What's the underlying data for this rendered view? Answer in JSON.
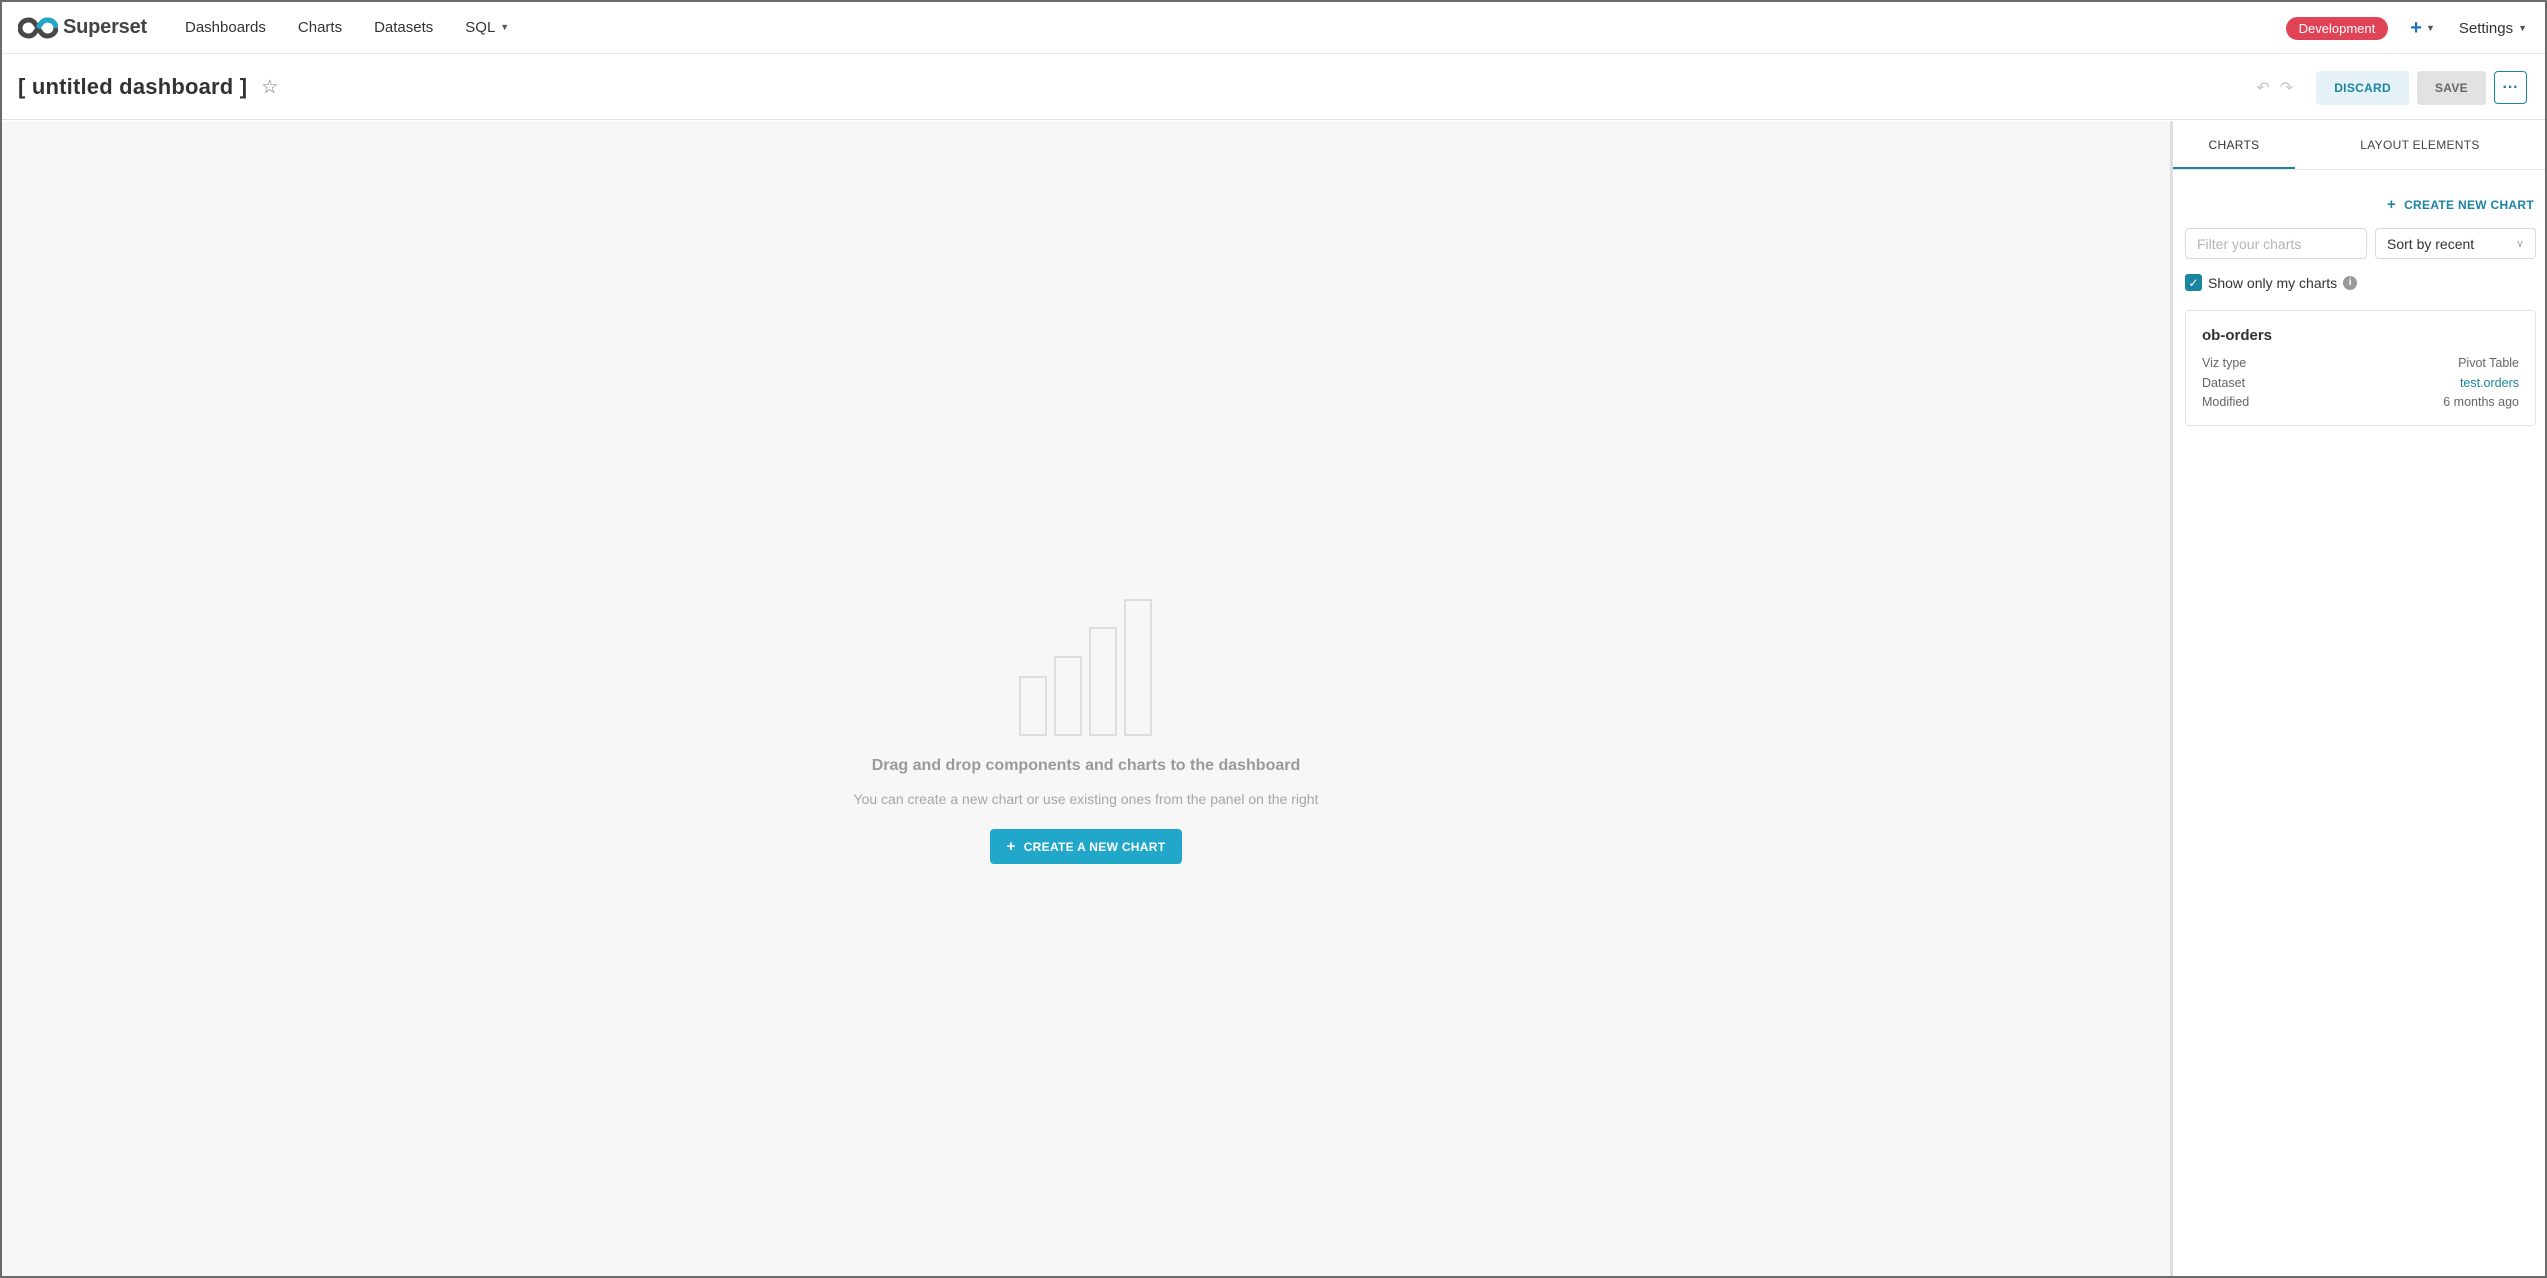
{
  "topnav": {
    "brand": "Superset",
    "items": [
      {
        "label": "Dashboards"
      },
      {
        "label": "Charts"
      },
      {
        "label": "Datasets"
      },
      {
        "label": "SQL"
      }
    ],
    "env_badge": "Development",
    "plus_label": "+",
    "settings_label": "Settings"
  },
  "header": {
    "title": "[ untitled dashboard ]",
    "discard_label": "DISCARD",
    "save_label": "SAVE",
    "more_label": "···"
  },
  "canvas": {
    "empty_title": "Drag and drop components and charts to the dashboard",
    "empty_subtitle": "You can create a new chart or use existing ones from the panel on the right",
    "create_button": "CREATE A NEW CHART"
  },
  "panel": {
    "tabs": [
      {
        "label": "CHARTS"
      },
      {
        "label": "LAYOUT ELEMENTS"
      }
    ],
    "create_link": "CREATE NEW CHART",
    "filter_placeholder": "Filter your charts",
    "sort_value": "Sort by recent",
    "show_mine_label": "Show only my charts",
    "card": {
      "title": "ob-orders",
      "rows": [
        {
          "label": "Viz type",
          "value": "Pivot Table"
        },
        {
          "label": "Dataset",
          "value": "test.orders"
        },
        {
          "label": "Modified",
          "value": "6 months ago"
        }
      ]
    }
  },
  "colors": {
    "accent": "#1a85a0",
    "primary_button": "#20a7c9",
    "badge": "#e04355",
    "canvas_bg": "#f7f7f7"
  },
  "icons": [
    "superset-logo-icon",
    "caret-down-icon",
    "plus-icon",
    "star-icon",
    "undo-icon",
    "redo-icon",
    "more-icon",
    "empty-chart-icon",
    "chevron-down-icon",
    "check-icon",
    "info-icon"
  ]
}
